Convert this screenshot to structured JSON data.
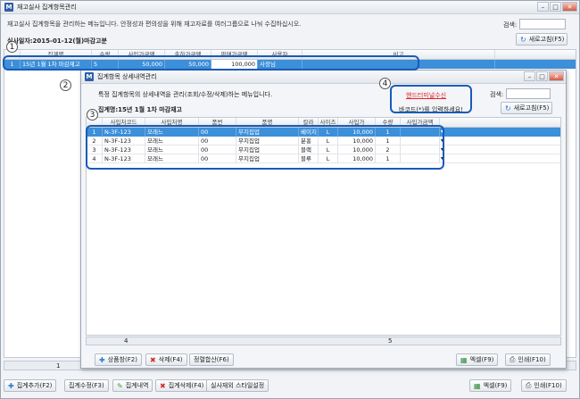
{
  "main": {
    "title": "재고실사 집계항목관리",
    "description": "재고실사 집계항목을 관리하는 메뉴입니다. 안정성과 편의성을 위해 재고자료를 여러그룹으로 나눠 수집하십시오.",
    "search_label": "검색:",
    "refresh_label": "새로고침(F5)",
    "date_info": "실사일자:2015-01-12(월)마감고분",
    "columns": [
      "집계명",
      "수량",
      "사입가금액",
      "출하가금액",
      "판매가금액",
      "사용자",
      "비고"
    ],
    "rows": [
      {
        "no": "1",
        "name": "15년 1월 1차 마감재고",
        "qty": "5",
        "buy": "50,000",
        "ship": "50,000",
        "sell": "100,000",
        "user": "사장님",
        "note": ""
      }
    ],
    "footer_count": "1",
    "buttons": {
      "add": "집계추가(F2)",
      "edit": "집계수정(F3)",
      "detail": "집계내역",
      "delete": "집계삭제(F4)",
      "style": "실사재외 스타일설정",
      "excel": "엑셀(F9)",
      "print": "인쇄(F10)"
    }
  },
  "detail": {
    "title": "집계항목 상세내역관리",
    "description": "특정 집계항목의 상세내역을 관리(조회/수정/삭제)하는 메뉴입니다.",
    "group_name": "집계명:15년 1월 1차 마감재고",
    "scanner_link": "핸드터미널수신",
    "barcode_prompt": "바코드(*)를 입력하세요!",
    "search_label": "검색:",
    "refresh_label": "새로고침(F5)",
    "columns": [
      "사입처코드",
      "사입처명",
      "품번",
      "품명",
      "칼라",
      "사이즈",
      "사입가",
      "수량",
      "사입가금액"
    ],
    "rows": [
      {
        "no": "1",
        "code": "N-3F-123",
        "vendor": "모래느",
        "item_no": "00",
        "item": "무지집업",
        "color": "베이지",
        "size": "L",
        "price": "10,000",
        "qty": "1",
        "amount": ""
      },
      {
        "no": "2",
        "code": "N-3F-123",
        "vendor": "모래느",
        "item_no": "00",
        "item": "무지집업",
        "color": "분홍",
        "size": "L",
        "price": "10,000",
        "qty": "1",
        "amount": ""
      },
      {
        "no": "3",
        "code": "N-3F-123",
        "vendor": "모래느",
        "item_no": "00",
        "item": "무지집업",
        "color": "블랙",
        "size": "L",
        "price": "10,000",
        "qty": "2",
        "amount": ""
      },
      {
        "no": "4",
        "code": "N-3F-123",
        "vendor": "모래느",
        "item_no": "00",
        "item": "무지집업",
        "color": "블루",
        "size": "L",
        "price": "10,000",
        "qty": "1",
        "amount": ""
      }
    ],
    "footer_count": "4",
    "footer_qty": "5",
    "buttons": {
      "add": "상품창(F2)",
      "delete": "삭제(F4)",
      "sort": "정렬합산(F6)",
      "excel": "엑셀(F9)",
      "print": "인쇄(F10)"
    }
  },
  "callouts": [
    "1",
    "2",
    "3",
    "4"
  ],
  "colors": {
    "accent": "#1a5bb8",
    "selected_row": "#3c8fd9",
    "link_red": "#e0262a"
  }
}
